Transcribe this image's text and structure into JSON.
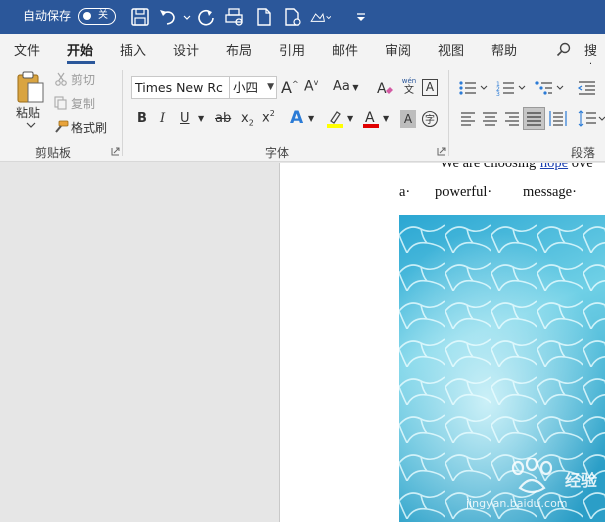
{
  "titlebar": {
    "autosave_label": "自动保存",
    "autosave_state": "关",
    "quick_access_icons": [
      "save-icon",
      "undo-icon",
      "redo-icon",
      "print-preview-icon",
      "new-document-icon",
      "open-file-icon",
      "format-icon",
      "customize-qat-icon"
    ]
  },
  "tabs": [
    "文件",
    "开始",
    "插入",
    "设计",
    "布局",
    "引用",
    "邮件",
    "审阅",
    "视图",
    "帮助"
  ],
  "active_tab": "开始",
  "search_label": "搜索",
  "clipboard": {
    "paste": "粘贴",
    "cut": "剪切",
    "copy": "复制",
    "format_painter": "格式刷",
    "group_label": "剪贴板"
  },
  "font": {
    "font_name": "Times New Rc",
    "font_size": "小四",
    "group_label": "字体",
    "bold": "B",
    "italic": "I",
    "underline": "U",
    "strikethrough": "ab",
    "subscript": "x",
    "superscript": "x",
    "text_effects": "A",
    "highlight_color": "#ffff00",
    "font_color": "#e00000",
    "char_shading": "A",
    "grow_font": "A",
    "shrink_font": "A",
    "change_case": "Aa",
    "pinyin_top": "wén",
    "pinyin_bottom": "文",
    "char_border": "A"
  },
  "paragraph": {
    "group_label": "段落"
  },
  "document": {
    "line1_prefix": "We are choosing",
    "line1_link": "hope",
    "line1_suffix": "ove",
    "words": [
      "a·",
      "powerful·",
      "message·"
    ]
  },
  "watermark": {
    "brand": "经验",
    "url": "jingyan.baidu.com"
  },
  "colors": {
    "titlebar": "#2b579a",
    "ribbon": "#f3f3f3",
    "canvas": "#e6e6e6"
  }
}
